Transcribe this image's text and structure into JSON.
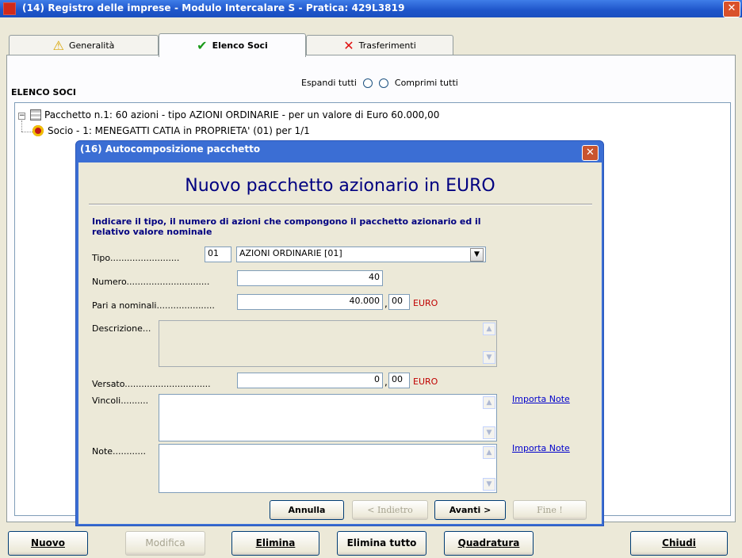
{
  "window": {
    "title": "(14) Registro delle imprese - Modulo Intercalare S - Pratica: 429L3819",
    "close_glyph": "✕"
  },
  "tabs": [
    {
      "label": "Generalità",
      "icon": "warning-person-icon",
      "glyph": "⚠"
    },
    {
      "label": "Elenco Soci",
      "icon": "check-icon",
      "glyph": "✔"
    },
    {
      "label": "Trasferimenti",
      "icon": "red-x-icon",
      "glyph": "✕"
    }
  ],
  "section": {
    "label": "ELENCO SOCI",
    "expand_label": "Espandi tutti",
    "collapse_label": "Comprimi tutti"
  },
  "tree": {
    "package_text": "Pacchetto n.1: 60 azioni - tipo AZIONI ORDINARIE - per un valore di Euro 60.000,00",
    "member_text": "Socio - 1: MENEGATTI CATIA in PROPRIETA' (01) per 1/1",
    "collapse_glyph": "−"
  },
  "bottom_buttons": {
    "nuovo": "Nuovo",
    "modifica": "Modifica",
    "elimina": "Elimina",
    "elimina_tutto": "Elimina tutto",
    "quadratura": "Quadratura",
    "chiudi": "Chiudi"
  },
  "dialog": {
    "title": "(16) Autocomposizione pacchetto",
    "close_glyph": "✕",
    "heading": "Nuovo pacchetto azionario in EURO",
    "instructions": "Indicare il tipo, il numero di azioni che compongono il pacchetto azionario ed il relativo valore nominale",
    "fields": {
      "tipo_label": "Tipo.........................",
      "tipo_code": "01",
      "tipo_value": "AZIONI ORDINARIE [01]",
      "numero_label": "Numero..............................",
      "numero_value": "40",
      "nominali_label": "Pari a  nominali.....................",
      "nominali_int": "40.000",
      "nominali_dec": "00",
      "descrizione_label": "Descrizione...",
      "versato_label": "Versato...............................",
      "versato_int": "0",
      "versato_dec": "00",
      "vincoli_label": "Vincoli..........",
      "note_label": "Note............",
      "currency": "EURO",
      "comma": ","
    },
    "links": {
      "importa_note_1": "Importa Note",
      "importa_note_2": "Importa Note"
    },
    "buttons": {
      "annulla": "Annulla",
      "indietro": "< Indietro",
      "avanti": "Avanti >",
      "fine": "Fine !"
    },
    "glyphs": {
      "up": "▲",
      "down": "▼"
    }
  }
}
